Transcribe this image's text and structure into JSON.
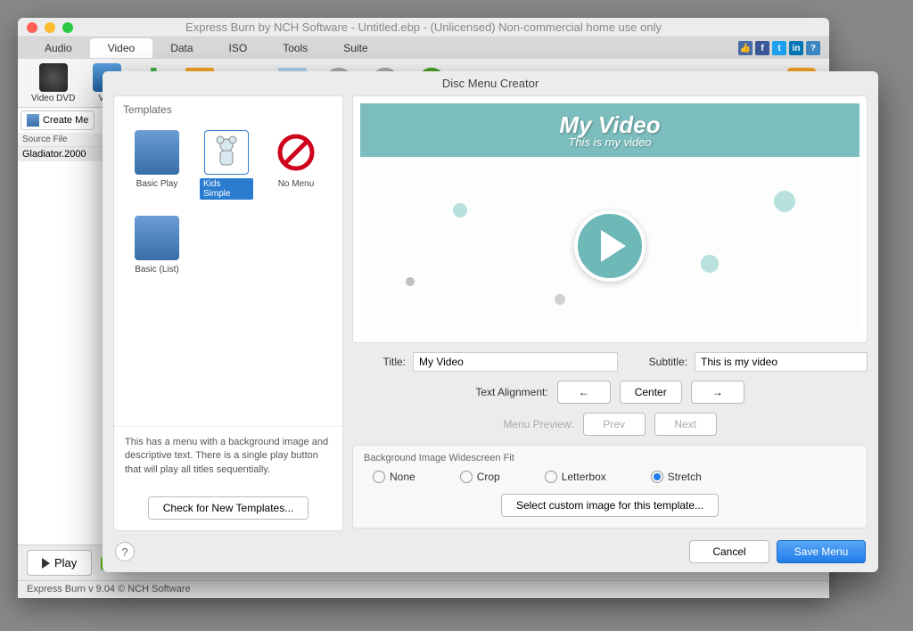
{
  "window": {
    "title": "Express Burn by NCH Software - Untitled.ebp - (Unlicensed) Non-commercial home use only"
  },
  "tabs": [
    "Audio",
    "Video",
    "Data",
    "ISO",
    "Tools",
    "Suite"
  ],
  "toolbar": {
    "video_dvd": "Video DVD",
    "video": "Vide"
  },
  "sidebar": {
    "create_menu": "Create Me",
    "source_file_header": "Source File",
    "file_row": "Gladiator.2000"
  },
  "bottom": {
    "play": "Play"
  },
  "status": "Express Burn v 9.04 © NCH Software",
  "modal": {
    "title": "Disc Menu Creator",
    "templates_header": "Templates",
    "templates": {
      "basic_play": "Basic Play",
      "kids_simple": "Kids Simple",
      "no_menu": "No Menu",
      "basic_list": "Basic (List)"
    },
    "template_desc": "This has a menu with a background image and descriptive text. There is a single play button that will play all titles sequentially.",
    "check_templates": "Check for New Templates...",
    "preview": {
      "title": "My Video",
      "subtitle": "This is my video"
    },
    "form": {
      "title_label": "Title:",
      "title_value": "My Video",
      "subtitle_label": "Subtitle:",
      "subtitle_value": "This is my video",
      "text_alignment_label": "Text Alignment:",
      "center": "Center",
      "menu_preview_label": "Menu Preview:",
      "prev": "Prev",
      "next": "Next"
    },
    "fit": {
      "legend": "Background Image Widescreen Fit",
      "none": "None",
      "crop": "Crop",
      "letterbox": "Letterbox",
      "stretch": "Stretch"
    },
    "custom_image": "Select custom image for this template...",
    "help": "?",
    "cancel": "Cancel",
    "save": "Save Menu"
  }
}
